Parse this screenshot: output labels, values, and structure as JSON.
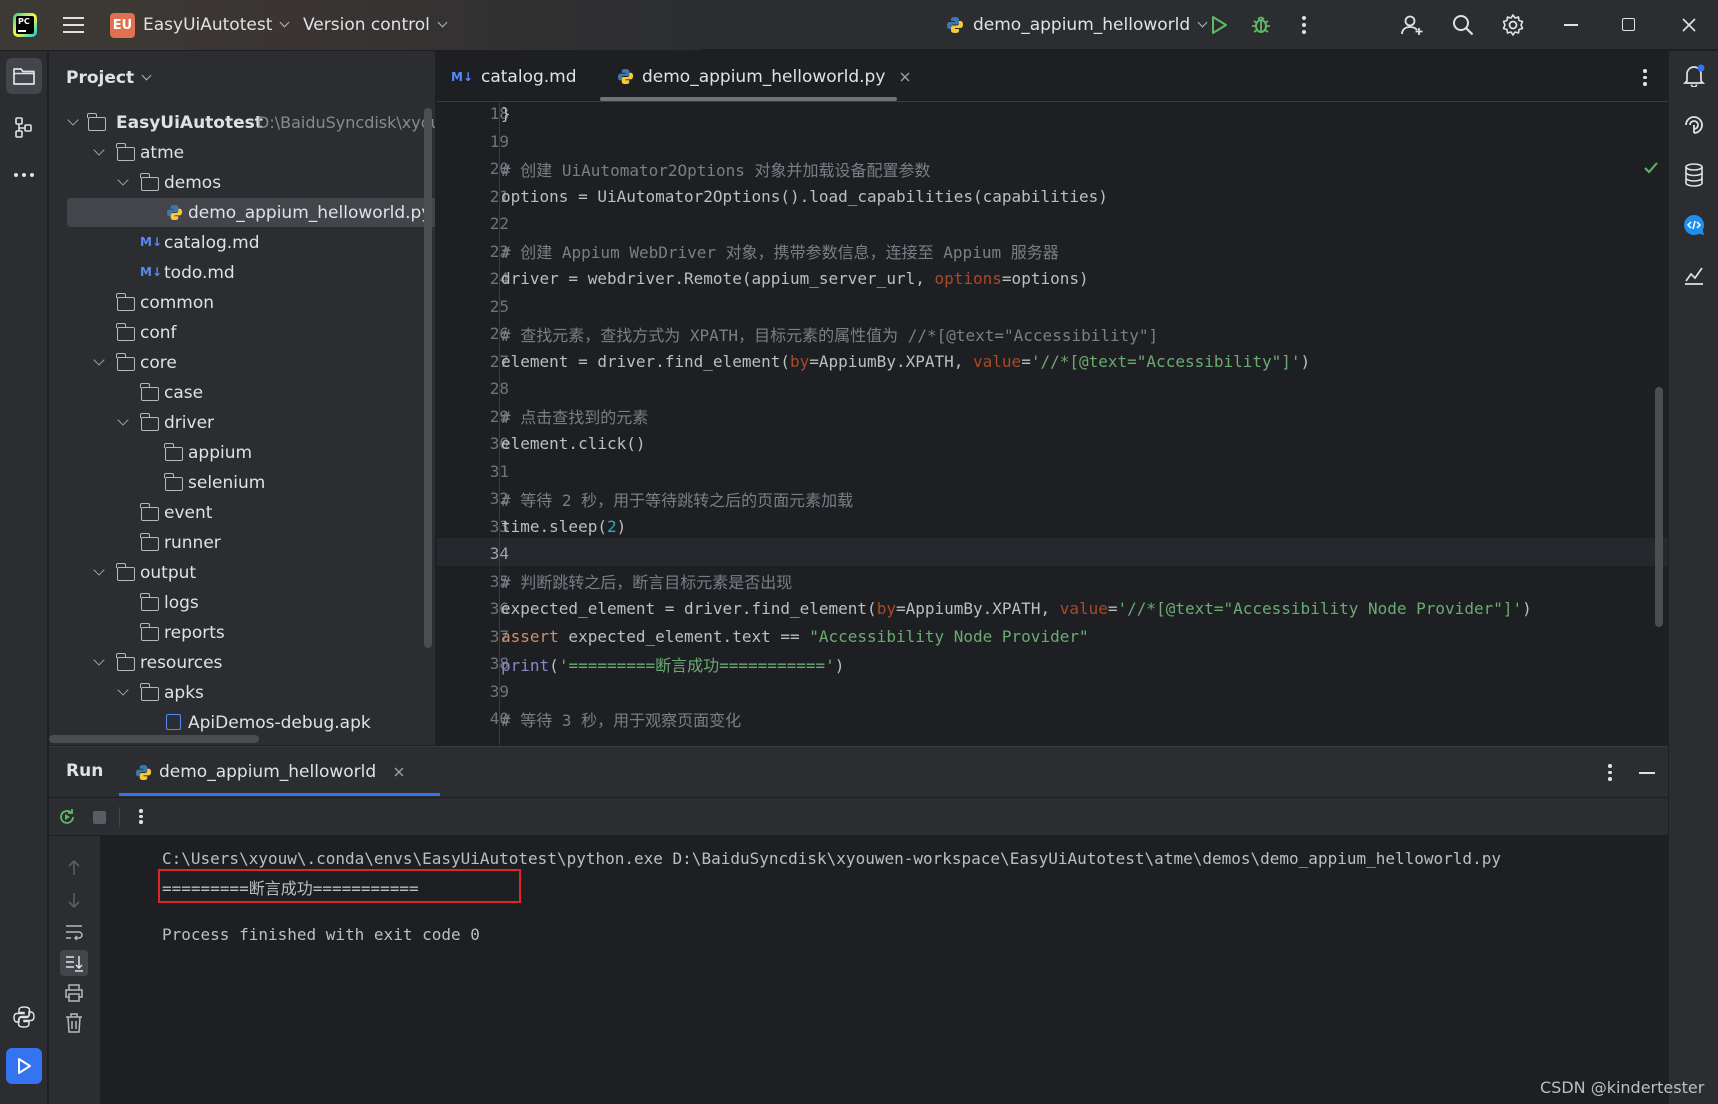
{
  "titlebar": {
    "project_badge": "EU",
    "project_name": "EasyUiAutotest",
    "vcs": "Version control",
    "run_config": "demo_appium_helloworld"
  },
  "project_panel": {
    "title": "Project",
    "root_name": "EasyUiAutotest",
    "root_path": "D:\\BaiduSyncdisk\\xyouwen-workspace\\EasyUiAutotest",
    "items": [
      {
        "label": "atme"
      },
      {
        "label": "demos"
      },
      {
        "label": "demo_appium_helloworld.py"
      },
      {
        "label": "catalog.md"
      },
      {
        "label": "todo.md"
      },
      {
        "label": "common"
      },
      {
        "label": "conf"
      },
      {
        "label": "core"
      },
      {
        "label": "case"
      },
      {
        "label": "driver"
      },
      {
        "label": "appium"
      },
      {
        "label": "selenium"
      },
      {
        "label": "event"
      },
      {
        "label": "runner"
      },
      {
        "label": "output"
      },
      {
        "label": "logs"
      },
      {
        "label": "reports"
      },
      {
        "label": "resources"
      },
      {
        "label": "apks"
      },
      {
        "label": "ApiDemos-debug.apk"
      }
    ]
  },
  "editor": {
    "tabs": [
      {
        "label": "catalog.md"
      },
      {
        "label": "demo_appium_helloworld.py"
      }
    ],
    "lines": [
      {
        "n": "18",
        "text": "}"
      },
      {
        "n": "19",
        "text": ""
      },
      {
        "n": "20",
        "text": "# 创建 UiAutomator2Options 对象并加载设备配置参数"
      },
      {
        "n": "21",
        "text": "options = UiAutomator2Options().load_capabilities(capabilities)"
      },
      {
        "n": "22",
        "text": ""
      },
      {
        "n": "23",
        "text": "# 创建 Appium WebDriver 对象，携带参数信息，连接至 Appium 服务器"
      },
      {
        "n": "24",
        "a": "driver = webdriver.Remote(appium_server_url, ",
        "b": "options",
        "c": "=options)"
      },
      {
        "n": "25",
        "text": ""
      },
      {
        "n": "26",
        "text": "# 查找元素，查找方式为 XPATH，目标元素的属性值为 //*[@text=\"Accessibility\"]"
      },
      {
        "n": "27",
        "a": "element = driver.find_element(",
        "b": "by",
        "c": "=AppiumBy.XPATH, ",
        "d": "value",
        "e": "=",
        "f": "'//*[@text=\"Accessibility\"]'",
        "g": ")"
      },
      {
        "n": "28",
        "text": ""
      },
      {
        "n": "29",
        "text": "# 点击查找到的元素"
      },
      {
        "n": "30",
        "text": "element.click()"
      },
      {
        "n": "31",
        "text": ""
      },
      {
        "n": "32",
        "text": "# 等待 2 秒，用于等待跳转之后的页面元素加载"
      },
      {
        "n": "33",
        "a": "time.sleep(",
        "b": "2",
        "c": ")"
      },
      {
        "n": "34",
        "text": ""
      },
      {
        "n": "35",
        "text": "# 判断跳转之后，断言目标元素是否出现"
      },
      {
        "n": "36",
        "a": "expected_element = driver.find_element(",
        "b": "by",
        "c": "=AppiumBy.XPATH, ",
        "d": "value",
        "e": "=",
        "f": "'//*[@text=\"Accessibility Node Provider\"]'",
        "g": ")"
      },
      {
        "n": "37",
        "a": "assert",
        "b": " expected_element.text == ",
        "c": "\"Accessibility Node Provider\""
      },
      {
        "n": "38",
        "a": "print",
        "b": "(",
        "c": "'=========断言成功==========='",
        "d": ")"
      },
      {
        "n": "39",
        "text": ""
      },
      {
        "n": "40",
        "text": "# 等待 3 秒，用于观察页面变化"
      }
    ]
  },
  "run_panel": {
    "title": "Run",
    "tab_label": "demo_appium_helloworld",
    "console": [
      "C:\\Users\\xyouw\\.conda\\envs\\EasyUiAutotest\\python.exe D:\\BaiduSyncdisk\\xyouwen-workspace\\EasyUiAutotest\\atme\\demos\\demo_appium_helloworld.py",
      "=========断言成功===========",
      "",
      "Process finished with exit code 0"
    ]
  },
  "watermark": "CSDN @kindertester",
  "colors": {
    "accent": "#3574f0",
    "highlight_box": "#e0242b",
    "run_green": "#5fb865"
  }
}
